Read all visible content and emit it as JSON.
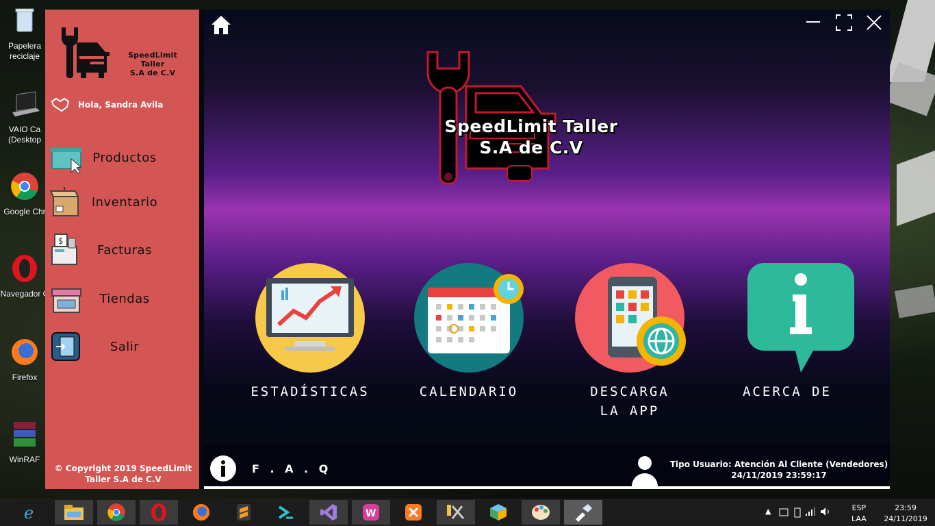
{
  "desktop": {
    "icons": [
      {
        "label": "Papelera de reciclaje",
        "line1": "Papelera",
        "line2": "reciclaje",
        "icon": "recycle-bin-icon"
      },
      {
        "label": "VAIO Ca (Desktop)",
        "line1": "VAIO Ca",
        "line2": "(Desktop",
        "icon": "laptop-icon"
      },
      {
        "label": "Google Chrome",
        "line1": "Google Chr",
        "line2": "",
        "icon": "chrome-icon"
      },
      {
        "label": "Navegador Opera",
        "line1": "Navegador C",
        "line2": "",
        "icon": "opera-icon"
      },
      {
        "label": "Firefox",
        "line1": "Firefox",
        "line2": "",
        "icon": "firefox-icon"
      },
      {
        "label": "WinRAR",
        "line1": "WinRAF",
        "line2": "",
        "icon": "winrar-icon"
      }
    ]
  },
  "sidebar": {
    "brand_line1": "SpeedLimit Taller",
    "brand_line2": "S.A de C.V",
    "greeting": "Hola, Sandra Avila",
    "menu": [
      {
        "label": "Productos",
        "icon": "basket-icon"
      },
      {
        "label": "Inventario",
        "icon": "box-icon"
      },
      {
        "label": "Facturas",
        "icon": "cash-register-icon"
      },
      {
        "label": "Tiendas",
        "icon": "store-icon"
      },
      {
        "label": "Salir",
        "icon": "exit-door-icon"
      }
    ],
    "copyright_line1": "© Copyright 2019 SpeedLimit",
    "copyright_line2": "Taller S.A de C.V"
  },
  "main": {
    "brand_line1": "SpeedLimit Taller",
    "brand_line2": "S.A de C.V",
    "tiles": [
      {
        "label": "ESTADÍSTICAS",
        "label2": "",
        "icon": "statistics-monitor-icon",
        "color": "#f7c948"
      },
      {
        "label": "CALENDARIO",
        "label2": "",
        "icon": "calendar-icon",
        "color": "#137a80"
      },
      {
        "label": "DESCARGA",
        "label2": "LA APP",
        "icon": "mobile-app-icon",
        "color": "#f25a62"
      },
      {
        "label": "ACERCA DE",
        "label2": "",
        "icon": "info-bubble-icon",
        "color": "#2dba9a"
      }
    ],
    "faq_label": "F . A . Q",
    "user_type": "Tipo Usuario: Atención Al Cliente (Vendedores)",
    "datetime": "24/11/2019 23:59:17"
  },
  "colors": {
    "sidebar_bg": "#d35654",
    "main_bg": "#050a10",
    "accent_purple": "#9b34b0"
  },
  "taskbar": {
    "apps": [
      "internet-explorer-icon",
      "file-explorer-icon",
      "chrome-icon",
      "opera-icon",
      "firefox-icon",
      "sublime-text-icon",
      "bracket-icon",
      "visual-studio-icon",
      "wamp-icon",
      "xampp-icon",
      "tools-icon",
      "cube-icon",
      "paint-icon",
      "app-icon"
    ],
    "lang1": "ESP",
    "lang2": "LAA",
    "time": "23:59",
    "date": "24/11/2019"
  }
}
